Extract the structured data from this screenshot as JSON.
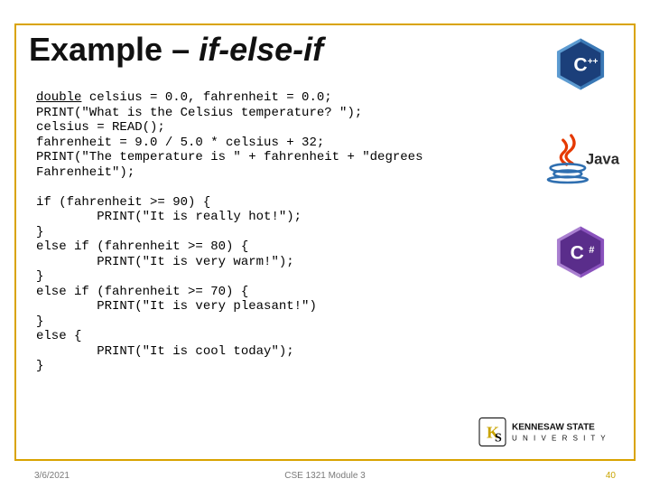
{
  "title": {
    "plain": "Example – ",
    "italic": "if-else-if"
  },
  "code": {
    "l1a": "double",
    "l1b": " celsius = 0.0, fahrenheit = 0.0;",
    "l2": "PRINT(\"What is the Celsius temperature? \");",
    "l3": "celsius = READ();",
    "l4": "fahrenheit = 9.0 / 5.0 * celsius + 32;",
    "l5": "PRINT(\"The temperature is \" + fahrenheit + \"degrees",
    "l6": "Fahrenheit\");",
    "l7": "",
    "l8": "if (fahrenheit >= 90) {",
    "l9": "        PRINT(\"It is really hot!\");",
    "l10": "}",
    "l11": "else if (fahrenheit >= 80) {",
    "l12": "        PRINT(\"It is very warm!\");",
    "l13": "}",
    "l14": "else if (fahrenheit >= 70) {",
    "l15": "        PRINT(\"It is very pleasant!\")",
    "l16": "}",
    "l17": "else {",
    "l18": "        PRINT(\"It is cool today\");",
    "l19": "}"
  },
  "logos": {
    "cpp": "C++",
    "java": "Java",
    "cs": "C#",
    "ksu1": "KENNESAW STATE",
    "ksu2": "U N I V E R S I T Y"
  },
  "footer": {
    "date": "3/6/2021",
    "mid": "CSE 1321 Module 3",
    "num": "40"
  }
}
